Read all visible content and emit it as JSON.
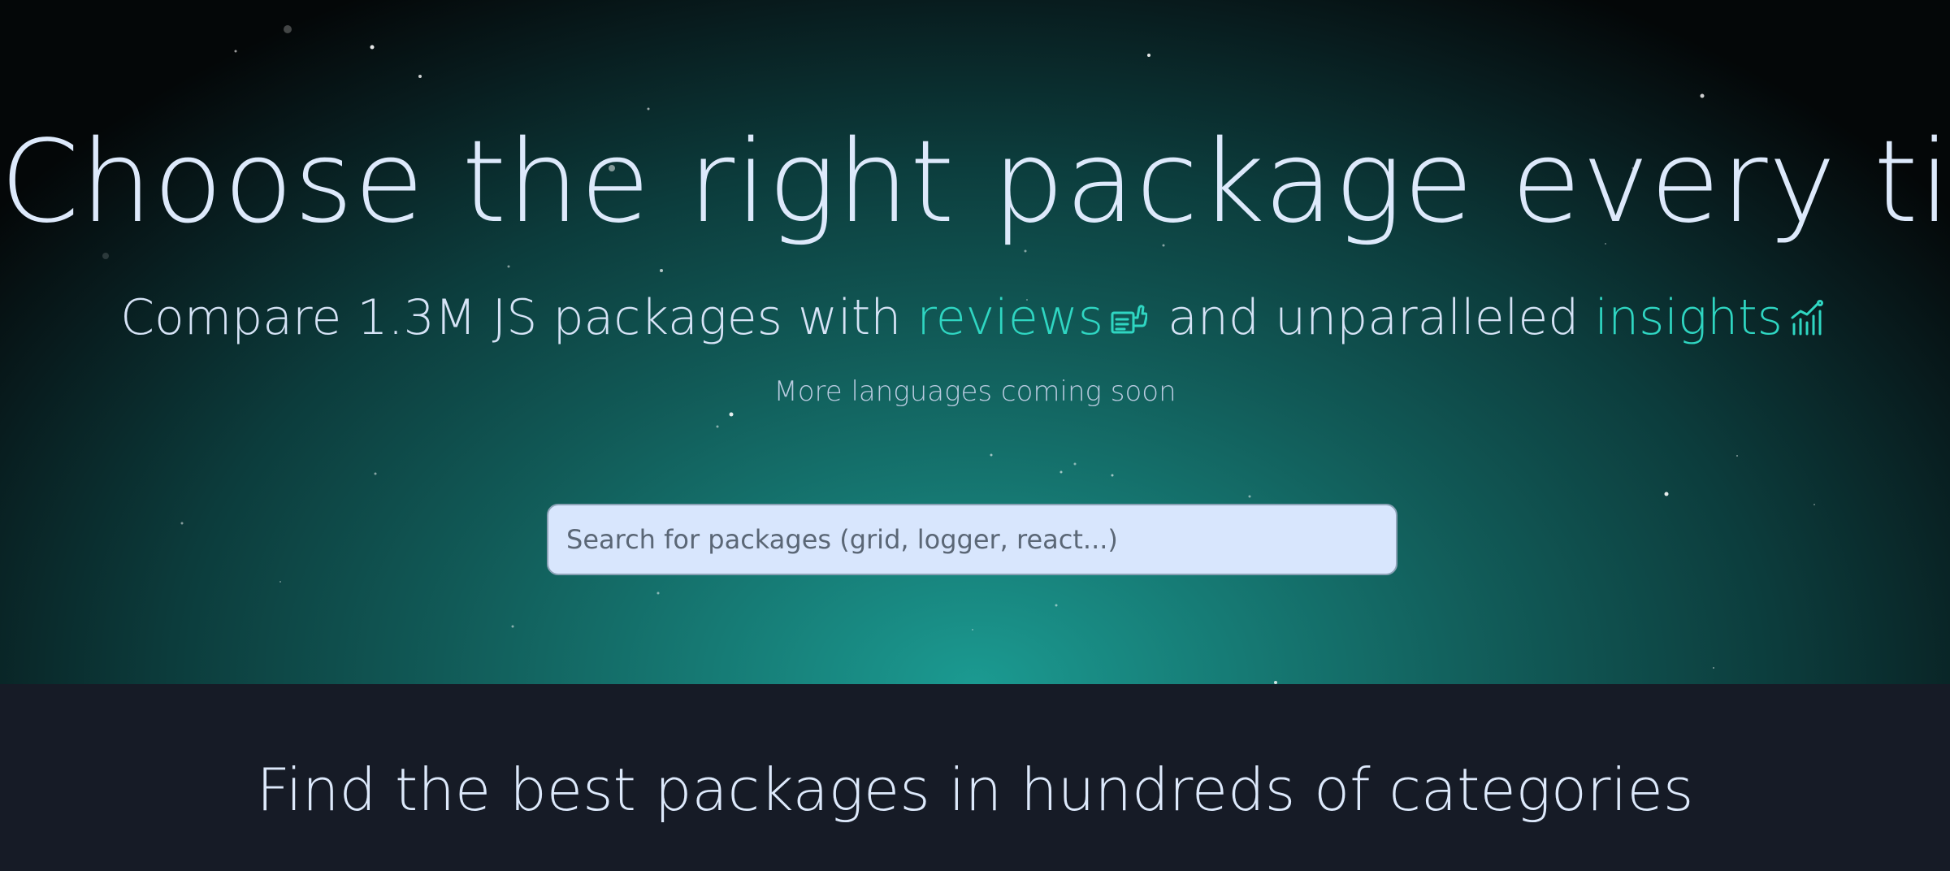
{
  "hero": {
    "headline": "Choose the right package every time",
    "subline": {
      "part1": "Compare 1.3M JS packages with",
      "reviews": "reviews",
      "reviews_icon": "thumbs-up-review-icon",
      "part2": "and unparalleled",
      "insights": "insights",
      "insights_icon": "bar-chart-icon"
    },
    "note": "More languages coming soon",
    "search": {
      "placeholder": "Search for packages (grid, logger, react...)"
    }
  },
  "categories": {
    "title": "Find the best packages in hundreds of categories"
  },
  "colors": {
    "accent": "#2fd6c2",
    "headline": "#dde9fb",
    "search_bg": "#d8e6fd",
    "section_bg": "#161b26"
  }
}
